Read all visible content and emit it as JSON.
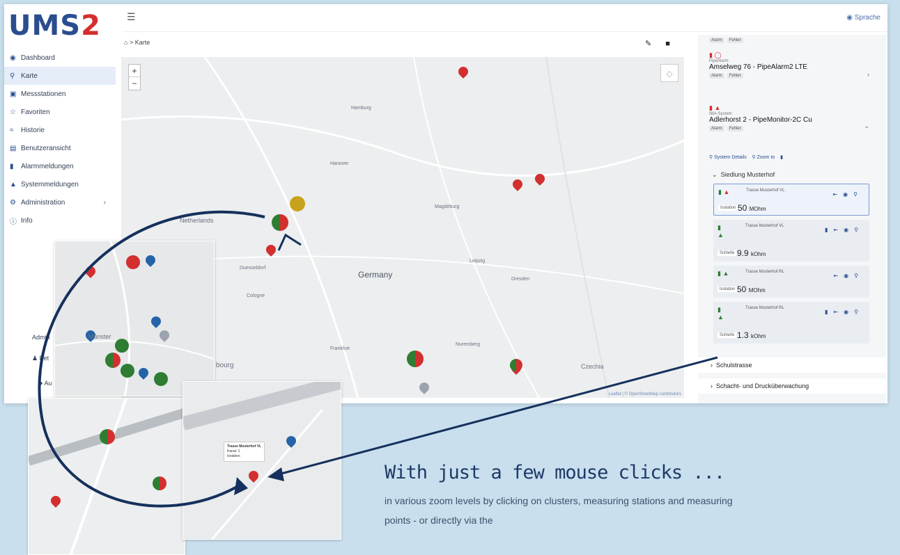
{
  "app": {
    "logo": "UMS2",
    "language_label": "Sprache"
  },
  "sidebar": {
    "items": [
      {
        "label": "Dashboard",
        "icon": "dashboard-icon"
      },
      {
        "label": "Karte",
        "icon": "map-pin-icon",
        "active": true
      },
      {
        "label": "Messstationen",
        "icon": "station-icon"
      },
      {
        "label": "Favoriten",
        "icon": "star-icon"
      },
      {
        "label": "Historie",
        "icon": "chart-line-icon"
      },
      {
        "label": "Benutzeransicht",
        "icon": "user-view-icon"
      },
      {
        "label": "Alarmmeldungen",
        "icon": "alarm-icon"
      },
      {
        "label": "Systemmeldungen",
        "icon": "warning-icon"
      },
      {
        "label": "Administration",
        "icon": "gear-icon",
        "has_children": true
      },
      {
        "label": "Info",
        "icon": "info-icon"
      }
    ],
    "admin_label": "Admin",
    "user_label": "Pet",
    "logout_label": "Au"
  },
  "breadcrumb": {
    "home_icon": "home-icon",
    "current": "Karte"
  },
  "map": {
    "labels": {
      "country": "Germany",
      "netherlands": "Netherlands",
      "czechia": "Czechia",
      "hamburg": "Hamburg",
      "magdeburg": "Magdeburg",
      "leipzig": "Leipzig",
      "dresden": "Dresden",
      "cologne": "Cologne",
      "dusseldorf": "Duesseldorf",
      "frankfurt": "Frankfurt",
      "nuremberg": "Nuremberg",
      "hanover": "Hanover",
      "luxembourg": "bourg"
    },
    "attribution": "Leaflet | © OpenStreetMap contributors"
  },
  "panel": {
    "top_badges": [
      "Alarm",
      "Fehler"
    ],
    "systems": [
      {
        "type": "PipeAlarm",
        "title": "Amselweg 76 - PipeAlarm2 LTE",
        "badges": [
          "Alarm",
          "Fehler"
        ]
      },
      {
        "type": "IMA-System",
        "title": "Adlerhorst 2 - PipeMonitor-2C Cu",
        "badges": [
          "Alarm",
          "Fehler"
        ]
      }
    ],
    "actions": {
      "details": "System Details",
      "zoom": "Zoom to"
    },
    "group_open": "Siedlung Musterhof",
    "points": [
      {
        "name": "Trasse Musterhof VL",
        "measure": "Isolation",
        "value": "50",
        "unit": "MOhm"
      },
      {
        "name": "Trasse Musterhof VL",
        "measure": "Schleife",
        "value": "9.9",
        "unit": "kOhm"
      },
      {
        "name": "Trasse Musterhof RL",
        "measure": "Isolation",
        "value": "50",
        "unit": "MOhm"
      },
      {
        "name": "Trasse Musterhof RL",
        "measure": "Schleife",
        "value": "1.3",
        "unit": "kOhm"
      }
    ],
    "groups_closed": [
      "Schulstrasse",
      "Schacht- und Drucküberwachung"
    ]
  },
  "inset": {
    "tooltip_title": "Trasse Musterhof VL",
    "tooltip_line2": "Kanal: 1",
    "tooltip_line3": "Isolation",
    "city": "Münster"
  },
  "marketing": {
    "headline": "With just a few mouse clicks ...",
    "description": "in various zoom levels by clicking on clusters, measuring stations and measuring points - or directly via the"
  },
  "colors": {
    "brand": "#2a4d8f",
    "accent": "#d62e2e",
    "ok": "#2e7d32",
    "background": "#c9dfee"
  }
}
